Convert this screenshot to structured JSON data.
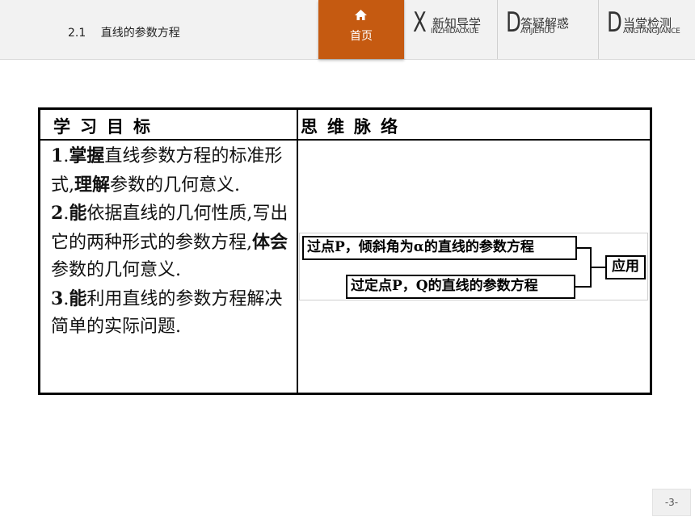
{
  "header": {
    "section_number": "2.1",
    "section_title": "直线的参数方程",
    "home_label": "首页",
    "nav": [
      {
        "letter": "X",
        "label": "新知导学",
        "pinyin": "INZHIDAOXUE"
      },
      {
        "letter": "D",
        "label": "答疑解惑",
        "pinyin": "AYIJIEHUO"
      },
      {
        "letter": "D",
        "label": "当堂检测",
        "pinyin": "ANGTANGJIANCE"
      }
    ]
  },
  "table": {
    "col1_header": "学习目标",
    "col2_header": "思维脉络",
    "goals": [
      {
        "num": "1",
        "sep": ".",
        "parts": [
          {
            "text": "掌握",
            "bold": true
          },
          {
            "text": "直线参数方程的标准形式,",
            "bold": false
          },
          {
            "text": "理解",
            "bold": true
          },
          {
            "text": "参数的几何意义.",
            "bold": false
          }
        ]
      },
      {
        "num": "2",
        "sep": ".",
        "parts": [
          {
            "text": "能",
            "bold": true
          },
          {
            "text": "依据直线的几何性质,写出它的两种形式的参数方程,",
            "bold": false
          },
          {
            "text": "体会",
            "bold": true
          },
          {
            "text": "参数的几何意义.",
            "bold": false
          }
        ]
      },
      {
        "num": "3",
        "sep": ".",
        "parts": [
          {
            "text": "能",
            "bold": true
          },
          {
            "text": "利用直线的参数方程解决简单的实际问题.",
            "bold": false
          }
        ]
      }
    ]
  },
  "diagram": {
    "box1": "过点P，倾斜角为α的直线的参数方程",
    "box2": "过定点P，Q的直线的参数方程",
    "box3": "应用"
  },
  "page_number": "-3-"
}
